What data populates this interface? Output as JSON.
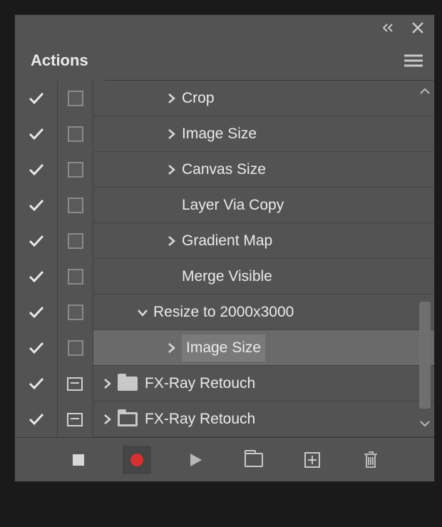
{
  "panel": {
    "title": "Actions"
  },
  "rows": [
    {
      "check": true,
      "box": true,
      "indent": 90,
      "caret": "right",
      "label": "Crop"
    },
    {
      "check": true,
      "box": true,
      "indent": 90,
      "caret": "right",
      "label": "Image Size"
    },
    {
      "check": true,
      "box": true,
      "indent": 90,
      "caret": "right",
      "label": "Canvas Size"
    },
    {
      "check": true,
      "box": true,
      "indent": 90,
      "caret": "none",
      "label": "Layer Via Copy"
    },
    {
      "check": true,
      "box": true,
      "indent": 90,
      "caret": "right",
      "label": "Gradient Map"
    },
    {
      "check": true,
      "box": true,
      "indent": 90,
      "caret": "none",
      "label": "Merge Visible"
    },
    {
      "check": true,
      "box": true,
      "indent": 50,
      "caret": "down",
      "label": "Resize to 2000x3000"
    },
    {
      "check": true,
      "box": true,
      "indent": 90,
      "caret": "right",
      "label": "Image Size",
      "selected": true
    },
    {
      "check": true,
      "dlg": true,
      "folder": "solid",
      "caret": "right",
      "label": "FX-Ray Retouch",
      "group": true
    },
    {
      "check": true,
      "dlg": true,
      "folder": "outline",
      "caret": "right",
      "label": "FX-Ray Retouch",
      "group": true
    }
  ],
  "footer": {
    "stop": "Stop",
    "record": "Record",
    "play": "Play",
    "newSet": "New Set",
    "newAction": "New Action",
    "delete": "Delete"
  }
}
